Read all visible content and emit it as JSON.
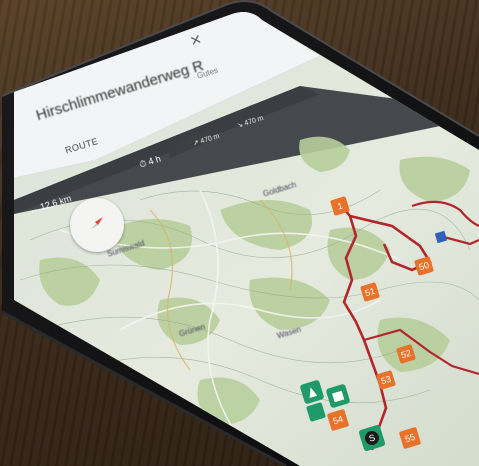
{
  "app": {
    "route_title": "Hirschlimmewanderweg R",
    "tab_route": "ROUTE",
    "tab_right": "Gutes",
    "close_icon": "close-icon"
  },
  "stats": {
    "distance": "↔ 12,6 km",
    "duration": "⏱ 4 h",
    "ascent": "↗ 470 m",
    "descent": "↘ 470 m"
  },
  "map": {
    "place_labels": [
      "Sumiswald",
      "Grünen",
      "Wasen",
      "Goldbach"
    ],
    "markers": [
      "50",
      "51",
      "52",
      "53",
      "54",
      "55"
    ],
    "colors": {
      "route": "#b3262b",
      "marker_orange": "#e8722a",
      "marker_green": "#1f9a68",
      "map_base": "#e6eadf",
      "forest": "#b7cf9c"
    }
  }
}
